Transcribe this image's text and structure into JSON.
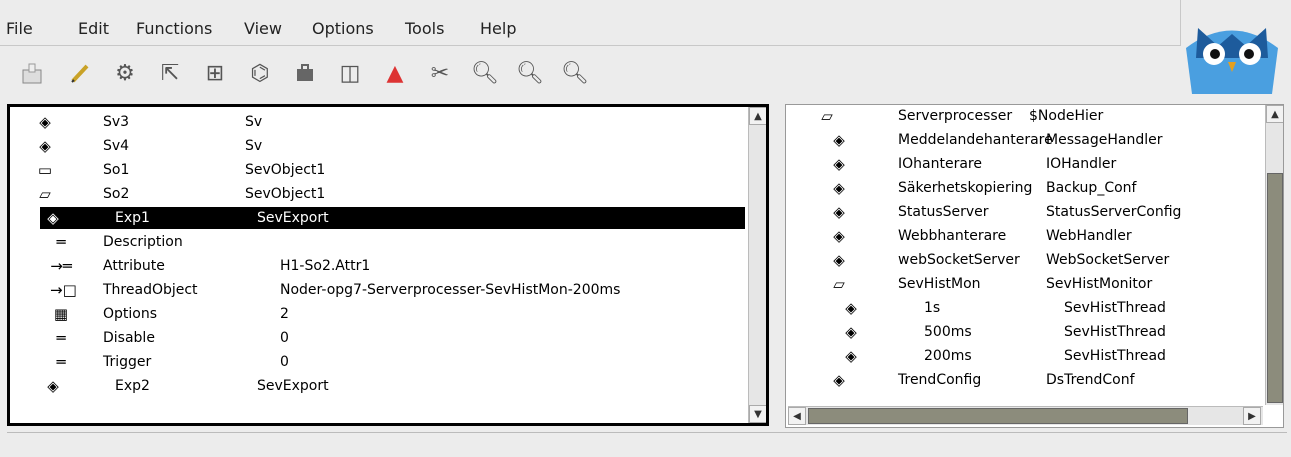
{
  "menu": {
    "file": "File",
    "edit": "Edit",
    "functions": "Functions",
    "view": "View",
    "options": "Options",
    "tools": "Tools",
    "help": "Help"
  },
  "toolbar": [
    "save-icon",
    "edit-icon",
    "gears-icon",
    "nav-icon",
    "hierarchy-icon",
    "plc-icon",
    "briefcase-icon",
    "panel-icon",
    "alarm-triangle-icon",
    "tools-icon",
    "zoom-in-icon",
    "zoom-out-icon",
    "zoom-reset-icon"
  ],
  "left": {
    "rows": [
      {
        "icon": "object-icon",
        "name": "Sv3",
        "cls": "Sv",
        "value": ""
      },
      {
        "icon": "object-icon",
        "name": "Sv4",
        "cls": "Sv",
        "value": ""
      },
      {
        "icon": "folder-closed-icon",
        "name": "So1",
        "cls": "SevObject1",
        "value": ""
      },
      {
        "icon": "folder-open-icon",
        "name": "So2",
        "cls": "SevObject1",
        "value": ""
      },
      {
        "icon": "object-icon",
        "name": "Exp1",
        "cls": "SevExport",
        "value": ""
      },
      {
        "icon": "attr-icon",
        "name": "Description",
        "cls": "",
        "value": ""
      },
      {
        "icon": "attrref-icon",
        "name": "Attribute",
        "cls": "",
        "value": "H1-So2.Attr1"
      },
      {
        "icon": "objref-icon",
        "name": "ThreadObject",
        "cls": "",
        "value": "Noder-opg7-Serverprocesser-SevHistMon-200ms"
      },
      {
        "icon": "mask-icon",
        "name": "Options",
        "cls": "",
        "value": "2"
      },
      {
        "icon": "attr-icon",
        "name": "Disable",
        "cls": "",
        "value": "0"
      },
      {
        "icon": "attr-icon",
        "name": "Trigger",
        "cls": "",
        "value": "0"
      },
      {
        "icon": "object-icon",
        "name": "Exp2",
        "cls": "SevExport",
        "value": ""
      }
    ]
  },
  "right": {
    "rows": [
      {
        "icon": "folder-open-icon",
        "name": "Serverprocesser",
        "cls": "$NodeHier"
      },
      {
        "icon": "object-icon",
        "name": "Meddelandehanterare",
        "cls": "MessageHandler"
      },
      {
        "icon": "object-icon",
        "name": "IOhanterare",
        "cls": "IOHandler"
      },
      {
        "icon": "object-icon",
        "name": "Säkerhetskopiering",
        "cls": "Backup_Conf"
      },
      {
        "icon": "object-icon",
        "name": "StatusServer",
        "cls": "StatusServerConfig"
      },
      {
        "icon": "object-icon",
        "name": "Webbhanterare",
        "cls": "WebHandler"
      },
      {
        "icon": "object-icon",
        "name": "webSocketServer",
        "cls": "WebSocketServer"
      },
      {
        "icon": "folder-open-icon",
        "name": "SevHistMon",
        "cls": "SevHistMonitor"
      },
      {
        "icon": "object-icon",
        "name": "1s",
        "cls": "SevHistThread"
      },
      {
        "icon": "object-icon",
        "name": "500ms",
        "cls": "SevHistThread"
      },
      {
        "icon": "object-icon",
        "name": "200ms",
        "cls": "SevHistThread"
      },
      {
        "icon": "object-icon",
        "name": "TrendConfig",
        "cls": "DsTrendConf"
      }
    ]
  },
  "colors": {
    "selection": "#000000",
    "thumb": "#8c8c7c",
    "logo": "#4a9fe0"
  }
}
